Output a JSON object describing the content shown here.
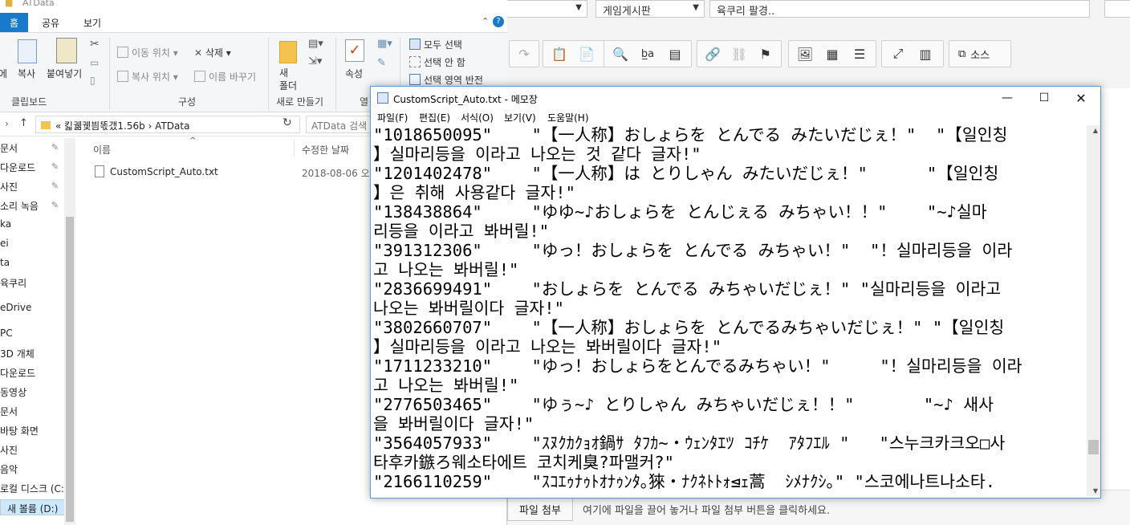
{
  "editor": {
    "category_select": "게임게시판",
    "title_input": "육쿠리 팔경..",
    "source_button": "소스",
    "attach_button": "파일 첨부",
    "attach_hint": "여기에 파일을 끌어 놓거나 파일 첨부 버튼을 클릭하세요."
  },
  "explorer": {
    "window_title": "ATData",
    "tabs": [
      "홈",
      "공유",
      "보기"
    ],
    "ribbon": {
      "copy": "복사",
      "paste": "붙여넣기",
      "move_to": "이동 위치",
      "copy_to": "복사 위치",
      "delete": "삭제",
      "rename": "이름 바꾸기",
      "new_folder": "새\n폴더",
      "properties": "속성",
      "select_all": "모두 선택",
      "select_none": "선택 안 함",
      "invert_selection": "선택 영역 반전",
      "group_clipboard": "클립보드",
      "group_organize": "구성",
      "group_new": "새로 만들기",
      "group_open": "열"
    },
    "address": {
      "crumbs": "«  킯궮궻븸똓갰1.56b  ›  ATData",
      "search_placeholder": "ATData 검색"
    },
    "nav_items": [
      "문서",
      "다운로드",
      "사진",
      "소리 녹음",
      "ka",
      "ei",
      "ta",
      "육쿠리",
      "eDrive",
      "PC",
      "3D 개체",
      "다운로드",
      "동영상",
      "문서",
      "바탕 화면",
      "사진",
      "음악",
      "로컬 디스크 (C:)",
      "새 볼륨 (D:)"
    ],
    "columns": {
      "name": "이름",
      "modified": "수정한 날짜"
    },
    "file": {
      "name": "CustomScript_Auto.txt",
      "modified": "2018-08-06 오"
    }
  },
  "notepad": {
    "title": "CustomScript_Auto.txt - 메모장",
    "menu": [
      "파일(F)",
      "편집(E)",
      "서식(O)",
      "보기(V)",
      "도움말(H)"
    ],
    "lines": [
      "\"1018650095\"    \"【一人称】おしょらを とんでる みたいだじぇ！\"  \"【일인칭",
      "】실마리등을 이라고 나오는 것 같다 글자!\"",
      "\"1201402478\"    \"【一人称】は とりしゃん みたいだじぇ！\"      \"【일인칭",
      "】은 취해 사용같다 글자!\"",
      "\"138438864\"     \"ゆゆ~♪おしょらを とんじぇる みちゃい！！\"    \"~♪실마",
      "리등을 이라고 봐버릴!\"",
      "\"391312306\"     \"ゆっ！おしょらを とんでる みちゃい！\"  \"！실마리등을 이라",
      "고 나오는 봐버릴!\"",
      "\"2836699491\"    \"おしょらを とんでる みちゃいだじぇ！\" \"실마리등을 이라고",
      "나오는 봐버릴이다 글자!\"",
      "\"3802660707\"    \"【一人称】おしょらを とんでるみちゃいだじぇ！\" \"【일인칭",
      "】실마리등을 이라고 나오는 봐버릴이다 글자!\"",
      "\"1711233210\"    \"ゆっ！おしょらをとんでるみちゃい！\"     \"！실마리등을 이라",
      "고 나오는 봐버릴!\"",
      "\"2776503465\"    \"ゆぅ~♪ とりしゃん みちゃいだじぇ！！\"       \"~♪ 새사",
      "을 봐버릴이다 글자!\"",
      "\"3564057933\"    \"ｽﾇｸｶｸｮｵ鍋ｻ ﾀﾌｶ~・ｳｪﾝﾀｴﾂ ｺﾁｹ  ｱﾀﾌｴﾙ \"   \"스누크카크오□사",
      "타후카鏃ろ웨소타에트 코치케臭?파맬커?\"",
      "\"2166110259\"    \"ｽｺｴｩﾅｩﾄｵﾅｩﾝﾀ｡猍・ﾅｸﾈﾄﾄｫ⊴ｪ蒿  ｼﾒﾅｸｼ｡\" \"스코에나트나소타."
    ]
  }
}
